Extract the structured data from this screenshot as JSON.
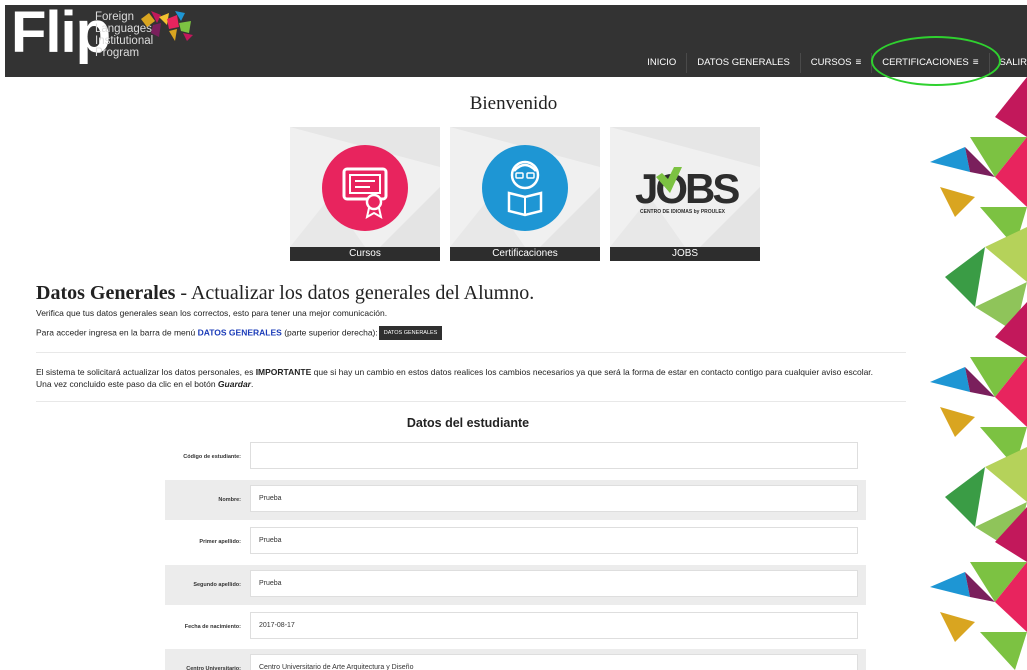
{
  "header": {
    "logo_main": "Flip",
    "logo_lines": [
      "Foreign",
      "Languages",
      "Institutional",
      "Program"
    ],
    "nav": [
      {
        "label": "INICIO",
        "menu": false
      },
      {
        "label": "DATOS GENERALES",
        "menu": false
      },
      {
        "label": "CURSOS",
        "menu": true
      },
      {
        "label": "CERTIFICACIONES",
        "menu": true
      },
      {
        "label": "SALIR",
        "menu": false
      }
    ],
    "menu_icon": "hamburger-icon",
    "highlight_color": "#2fd12f"
  },
  "welcome": "Bienvenido",
  "tiles": [
    {
      "caption": "Cursos",
      "icon": "certificate-icon",
      "color": "#e8245e"
    },
    {
      "caption": "Certificaciones",
      "icon": "student-reading-icon",
      "color": "#1e96d4"
    },
    {
      "caption": "JOBS",
      "icon": "jobs-logo",
      "logo_text": "JOBS",
      "logo_sub": "CENTRO DE IDIOMAS by PROULEX",
      "color": "#7cc242"
    }
  ],
  "section": {
    "title_bold": "Datos Generales",
    "title_rest": " - Actualizar los datos generales del Alumno.",
    "line1": "Verifica que tus datos generales sean los correctos, esto para tener una mejor comunicación.",
    "line2_pre": "Para acceder ingresa en la barra de menú ",
    "line2_link": "DATOS GENERALES",
    "line2_post": " (parte superior derecha):",
    "line2_button": "DATOS GENERALES",
    "para_pre": "El sistema te solicitará actualizar los datos personales, es ",
    "para_bold": "IMPORTANTE",
    "para_post": " que si hay un cambio en estos datos realices los cambios necesarios ya que será la forma de estar en contacto contigo para cualquier aviso escolar.",
    "para2_pre": "Una vez concluido este paso da clic en el botón ",
    "para2_bold": "Guardar",
    "para2_post": "."
  },
  "form": {
    "title": "Datos del estudiante",
    "fields": [
      {
        "label": "Código de estudiante:",
        "value": ""
      },
      {
        "label": "Nombre:",
        "value": "Prueba"
      },
      {
        "label": "Primer apellido:",
        "value": "Prueba"
      },
      {
        "label": "Segundo apellido:",
        "value": "Prueba"
      },
      {
        "label": "Fecha de nacimiento:",
        "value": "2017-08-17"
      },
      {
        "label": "Centro Universitario:",
        "value": "Centro Universitario de Arte Arquitectura y Diseño"
      }
    ]
  }
}
